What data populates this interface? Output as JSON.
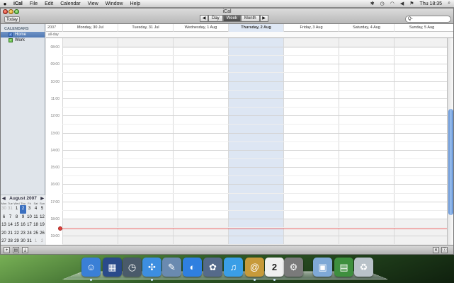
{
  "menubar": {
    "apple_icon": "apple-icon",
    "app_name": "iCal",
    "menus": [
      "File",
      "Edit",
      "Calendar",
      "View",
      "Window",
      "Help"
    ],
    "clock": "Thu 18:35"
  },
  "window": {
    "title": "iCal",
    "today_button": "Today",
    "view_buttons": [
      "Day",
      "Week",
      "Month"
    ],
    "selected_view": "Week",
    "search_placeholder": "Q-"
  },
  "sidebar": {
    "header": "CALENDARS",
    "calendars": [
      {
        "label": "Home",
        "selected": true,
        "color": "#4a7ed0"
      },
      {
        "label": "Work",
        "selected": false,
        "color": "#6cc34f"
      }
    ]
  },
  "mini_calendar": {
    "month": "August 2007",
    "days_of_week": [
      "Mon",
      "Tue",
      "Wed",
      "Thu",
      "Fri",
      "Sat",
      "Sun"
    ],
    "weeks": [
      [
        "30",
        "31",
        "1",
        "2",
        "3",
        "4",
        "5"
      ],
      [
        "6",
        "7",
        "8",
        "9",
        "10",
        "11",
        "12"
      ],
      [
        "13",
        "14",
        "15",
        "16",
        "17",
        "18",
        "19"
      ],
      [
        "20",
        "21",
        "22",
        "23",
        "24",
        "25",
        "26"
      ],
      [
        "27",
        "28",
        "29",
        "30",
        "31",
        "1",
        "2"
      ]
    ],
    "today": "2"
  },
  "week": {
    "year": "2007",
    "all_day_label": "all-day",
    "days": [
      "Monday, 30 Jul",
      "Tuesday, 31 Jul",
      "Wednesday, 1 Aug",
      "Thursday, 2 Aug",
      "Friday, 3 Aug",
      "Saturday, 4 Aug",
      "Sunday, 5 Aug"
    ],
    "today_index": 3,
    "hours": [
      "08:00",
      "09:00",
      "10:00",
      "11:00",
      "12:00",
      "13:00",
      "14:00",
      "15:00",
      "16:00",
      "17:00",
      "18:00",
      "19:00"
    ]
  },
  "dock": {
    "apps": [
      {
        "name": "finder-icon",
        "color": "#3a7fd6",
        "glyph": "☺"
      },
      {
        "name": "dashboard-icon",
        "color": "#2a4a8a",
        "glyph": "▦"
      },
      {
        "name": "time-machine-icon",
        "color": "#4a5a6a",
        "glyph": "◷"
      },
      {
        "name": "safari-icon",
        "color": "#3d8ee0",
        "glyph": "✣"
      },
      {
        "name": "preview-icon",
        "color": "#6a8ab0",
        "glyph": "✎"
      },
      {
        "name": "ichat-icon",
        "color": "#2f7fe0",
        "glyph": "◐"
      },
      {
        "name": "iphoto-icon",
        "color": "#556a8a",
        "glyph": "✿"
      },
      {
        "name": "itunes-icon",
        "color": "#3a9ee6",
        "glyph": "♫"
      },
      {
        "name": "address-book-icon",
        "color": "#c79a3a",
        "glyph": "@"
      },
      {
        "name": "ical-icon",
        "color": "#f0f0f0",
        "glyph": "2"
      },
      {
        "name": "system-preferences-icon",
        "color": "#7a7a7a",
        "glyph": "⚙"
      },
      {
        "name": "applications-folder-icon",
        "color": "#7fa9d6",
        "glyph": "▣"
      },
      {
        "name": "downloads-icon",
        "color": "#3e8f3e",
        "glyph": "▤"
      },
      {
        "name": "trash-icon",
        "color": "#b9c2c9",
        "glyph": "♻"
      }
    ]
  }
}
